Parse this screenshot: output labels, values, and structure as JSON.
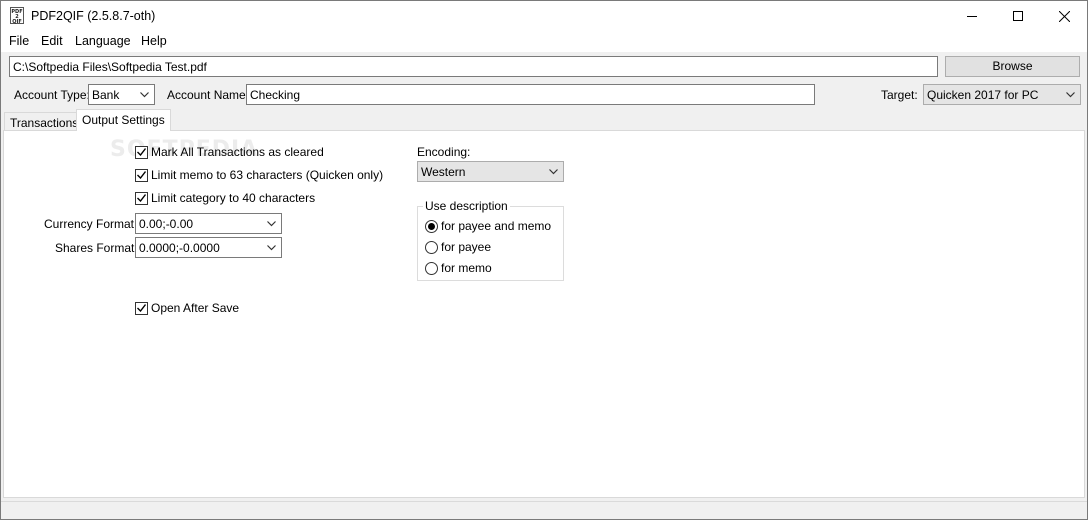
{
  "window": {
    "title": "PDF2QIF (2.5.8.7-oth)",
    "icon": "pdf-qif-file-icon",
    "icon_text": [
      "PDF",
      "2",
      "QIF"
    ]
  },
  "menu": [
    "File",
    "Edit",
    "Language",
    "Help"
  ],
  "file": {
    "path": "C:\\Softpedia Files\\Softpedia Test.pdf",
    "browse_label": "Browse"
  },
  "account": {
    "type_label": "Account Type:",
    "type_value": "Bank",
    "name_label": "Account Name:",
    "name_value": "Checking",
    "target_label": "Target:",
    "target_value": "Quicken 2017 for PC"
  },
  "tabs": [
    {
      "label": "Transactions",
      "active": false
    },
    {
      "label": "Output Settings",
      "active": true
    }
  ],
  "settings": {
    "mark_cleared": {
      "label": "Mark All Transactions as cleared",
      "checked": true
    },
    "limit_memo": {
      "label": "Limit memo to 63 characters (Quicken only)",
      "checked": true
    },
    "limit_category": {
      "label": "Limit category to 40 characters",
      "checked": true
    },
    "currency_label": "Currency Format:",
    "currency_value": "0.00;-0.00",
    "shares_label": "Shares Format:",
    "shares_value": "0.0000;-0.0000",
    "open_after_save": {
      "label": "Open After Save",
      "checked": true
    },
    "encoding_label": "Encoding:",
    "encoding_value": "Western",
    "use_description": {
      "title": "Use description",
      "options": [
        {
          "label": "for payee and memo",
          "selected": true
        },
        {
          "label": "for payee",
          "selected": false
        },
        {
          "label": "for memo",
          "selected": false
        }
      ]
    }
  },
  "watermark": "SOFTPEDIA",
  "colors": {
    "window_bg": "#f0f0f0",
    "panel_bg": "#ffffff",
    "border": "#7a7a7a"
  }
}
